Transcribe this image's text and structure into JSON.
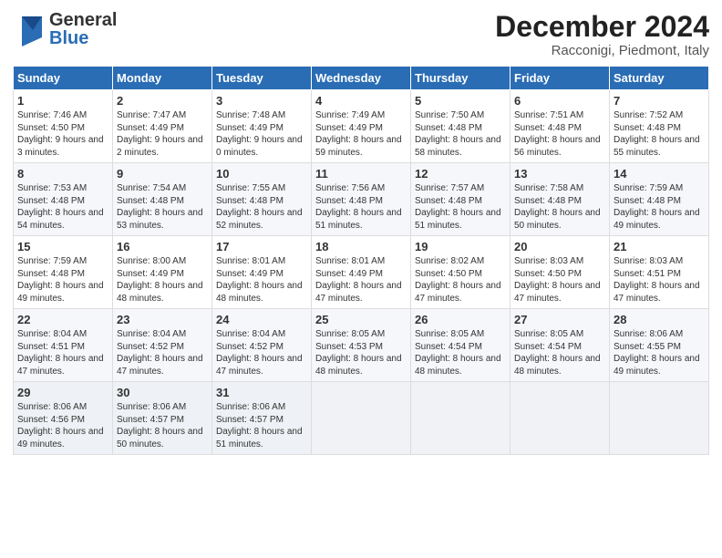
{
  "header": {
    "logo_general": "General",
    "logo_blue": "Blue",
    "title": "December 2024",
    "subtitle": "Racconigi, Piedmont, Italy"
  },
  "weekdays": [
    "Sunday",
    "Monday",
    "Tuesday",
    "Wednesday",
    "Thursday",
    "Friday",
    "Saturday"
  ],
  "weeks": [
    [
      {
        "day": "1",
        "sunrise": "Sunrise: 7:46 AM",
        "sunset": "Sunset: 4:50 PM",
        "daylight": "Daylight: 9 hours and 3 minutes."
      },
      {
        "day": "2",
        "sunrise": "Sunrise: 7:47 AM",
        "sunset": "Sunset: 4:49 PM",
        "daylight": "Daylight: 9 hours and 2 minutes."
      },
      {
        "day": "3",
        "sunrise": "Sunrise: 7:48 AM",
        "sunset": "Sunset: 4:49 PM",
        "daylight": "Daylight: 9 hours and 0 minutes."
      },
      {
        "day": "4",
        "sunrise": "Sunrise: 7:49 AM",
        "sunset": "Sunset: 4:49 PM",
        "daylight": "Daylight: 8 hours and 59 minutes."
      },
      {
        "day": "5",
        "sunrise": "Sunrise: 7:50 AM",
        "sunset": "Sunset: 4:48 PM",
        "daylight": "Daylight: 8 hours and 58 minutes."
      },
      {
        "day": "6",
        "sunrise": "Sunrise: 7:51 AM",
        "sunset": "Sunset: 4:48 PM",
        "daylight": "Daylight: 8 hours and 56 minutes."
      },
      {
        "day": "7",
        "sunrise": "Sunrise: 7:52 AM",
        "sunset": "Sunset: 4:48 PM",
        "daylight": "Daylight: 8 hours and 55 minutes."
      }
    ],
    [
      {
        "day": "8",
        "sunrise": "Sunrise: 7:53 AM",
        "sunset": "Sunset: 4:48 PM",
        "daylight": "Daylight: 8 hours and 54 minutes."
      },
      {
        "day": "9",
        "sunrise": "Sunrise: 7:54 AM",
        "sunset": "Sunset: 4:48 PM",
        "daylight": "Daylight: 8 hours and 53 minutes."
      },
      {
        "day": "10",
        "sunrise": "Sunrise: 7:55 AM",
        "sunset": "Sunset: 4:48 PM",
        "daylight": "Daylight: 8 hours and 52 minutes."
      },
      {
        "day": "11",
        "sunrise": "Sunrise: 7:56 AM",
        "sunset": "Sunset: 4:48 PM",
        "daylight": "Daylight: 8 hours and 51 minutes."
      },
      {
        "day": "12",
        "sunrise": "Sunrise: 7:57 AM",
        "sunset": "Sunset: 4:48 PM",
        "daylight": "Daylight: 8 hours and 51 minutes."
      },
      {
        "day": "13",
        "sunrise": "Sunrise: 7:58 AM",
        "sunset": "Sunset: 4:48 PM",
        "daylight": "Daylight: 8 hours and 50 minutes."
      },
      {
        "day": "14",
        "sunrise": "Sunrise: 7:59 AM",
        "sunset": "Sunset: 4:48 PM",
        "daylight": "Daylight: 8 hours and 49 minutes."
      }
    ],
    [
      {
        "day": "15",
        "sunrise": "Sunrise: 7:59 AM",
        "sunset": "Sunset: 4:48 PM",
        "daylight": "Daylight: 8 hours and 49 minutes."
      },
      {
        "day": "16",
        "sunrise": "Sunrise: 8:00 AM",
        "sunset": "Sunset: 4:49 PM",
        "daylight": "Daylight: 8 hours and 48 minutes."
      },
      {
        "day": "17",
        "sunrise": "Sunrise: 8:01 AM",
        "sunset": "Sunset: 4:49 PM",
        "daylight": "Daylight: 8 hours and 48 minutes."
      },
      {
        "day": "18",
        "sunrise": "Sunrise: 8:01 AM",
        "sunset": "Sunset: 4:49 PM",
        "daylight": "Daylight: 8 hours and 47 minutes."
      },
      {
        "day": "19",
        "sunrise": "Sunrise: 8:02 AM",
        "sunset": "Sunset: 4:50 PM",
        "daylight": "Daylight: 8 hours and 47 minutes."
      },
      {
        "day": "20",
        "sunrise": "Sunrise: 8:03 AM",
        "sunset": "Sunset: 4:50 PM",
        "daylight": "Daylight: 8 hours and 47 minutes."
      },
      {
        "day": "21",
        "sunrise": "Sunrise: 8:03 AM",
        "sunset": "Sunset: 4:51 PM",
        "daylight": "Daylight: 8 hours and 47 minutes."
      }
    ],
    [
      {
        "day": "22",
        "sunrise": "Sunrise: 8:04 AM",
        "sunset": "Sunset: 4:51 PM",
        "daylight": "Daylight: 8 hours and 47 minutes."
      },
      {
        "day": "23",
        "sunrise": "Sunrise: 8:04 AM",
        "sunset": "Sunset: 4:52 PM",
        "daylight": "Daylight: 8 hours and 47 minutes."
      },
      {
        "day": "24",
        "sunrise": "Sunrise: 8:04 AM",
        "sunset": "Sunset: 4:52 PM",
        "daylight": "Daylight: 8 hours and 47 minutes."
      },
      {
        "day": "25",
        "sunrise": "Sunrise: 8:05 AM",
        "sunset": "Sunset: 4:53 PM",
        "daylight": "Daylight: 8 hours and 48 minutes."
      },
      {
        "day": "26",
        "sunrise": "Sunrise: 8:05 AM",
        "sunset": "Sunset: 4:54 PM",
        "daylight": "Daylight: 8 hours and 48 minutes."
      },
      {
        "day": "27",
        "sunrise": "Sunrise: 8:05 AM",
        "sunset": "Sunset: 4:54 PM",
        "daylight": "Daylight: 8 hours and 48 minutes."
      },
      {
        "day": "28",
        "sunrise": "Sunrise: 8:06 AM",
        "sunset": "Sunset: 4:55 PM",
        "daylight": "Daylight: 8 hours and 49 minutes."
      }
    ],
    [
      {
        "day": "29",
        "sunrise": "Sunrise: 8:06 AM",
        "sunset": "Sunset: 4:56 PM",
        "daylight": "Daylight: 8 hours and 49 minutes."
      },
      {
        "day": "30",
        "sunrise": "Sunrise: 8:06 AM",
        "sunset": "Sunset: 4:57 PM",
        "daylight": "Daylight: 8 hours and 50 minutes."
      },
      {
        "day": "31",
        "sunrise": "Sunrise: 8:06 AM",
        "sunset": "Sunset: 4:57 PM",
        "daylight": "Daylight: 8 hours and 51 minutes."
      },
      null,
      null,
      null,
      null
    ]
  ]
}
